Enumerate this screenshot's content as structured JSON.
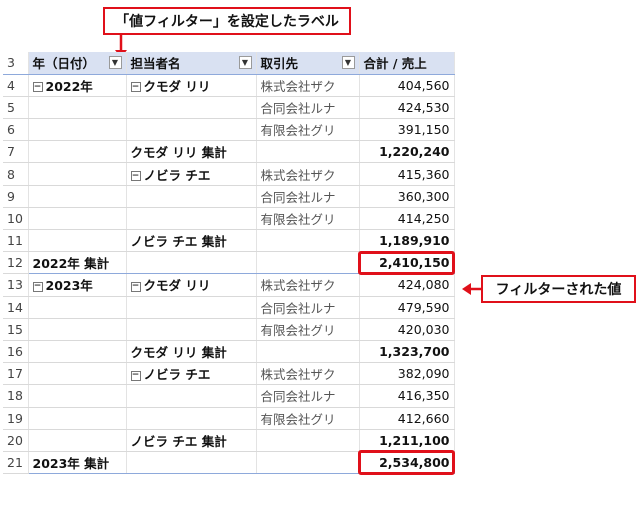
{
  "callouts": {
    "value_filter_label": "「値フィルター」を設定したラベル",
    "filtered_value": "フィルターされた値"
  },
  "headers": {
    "row": "3",
    "year": "年（日付）",
    "person": "担当者名",
    "client": "取引先",
    "sum": "合計 / 売上"
  },
  "rows": [
    {
      "n": "4",
      "year": "2022年",
      "person": "クモダ リリ",
      "client": "株式会社ザク",
      "value": "404,560"
    },
    {
      "n": "5",
      "year": "",
      "person": "",
      "client": "合同会社ルナ",
      "value": "424,530"
    },
    {
      "n": "6",
      "year": "",
      "person": "",
      "client": "有限会社グリ",
      "value": "391,150"
    },
    {
      "n": "7",
      "year": "",
      "person": "クモダ リリ 集計",
      "client": "",
      "value": "1,220,240"
    },
    {
      "n": "8",
      "year": "",
      "person": "ノビラ チエ",
      "client": "株式会社ザク",
      "value": "415,360"
    },
    {
      "n": "9",
      "year": "",
      "person": "",
      "client": "合同会社ルナ",
      "value": "360,300"
    },
    {
      "n": "10",
      "year": "",
      "person": "",
      "client": "有限会社グリ",
      "value": "414,250"
    },
    {
      "n": "11",
      "year": "",
      "person": "ノビラ チエ 集計",
      "client": "",
      "value": "1,189,910"
    },
    {
      "n": "12",
      "year": "2022年 集計",
      "person": "",
      "client": "",
      "value": "2,410,150"
    },
    {
      "n": "13",
      "year": "2023年",
      "person": "クモダ リリ",
      "client": "株式会社ザク",
      "value": "424,080"
    },
    {
      "n": "14",
      "year": "",
      "person": "",
      "client": "合同会社ルナ",
      "value": "479,590"
    },
    {
      "n": "15",
      "year": "",
      "person": "",
      "client": "有限会社グリ",
      "value": "420,030"
    },
    {
      "n": "16",
      "year": "",
      "person": "クモダ リリ 集計",
      "client": "",
      "value": "1,323,700"
    },
    {
      "n": "17",
      "year": "",
      "person": "ノビラ チエ",
      "client": "株式会社ザク",
      "value": "382,090"
    },
    {
      "n": "18",
      "year": "",
      "person": "",
      "client": "合同会社ルナ",
      "value": "416,350"
    },
    {
      "n": "19",
      "year": "",
      "person": "",
      "client": "有限会社グリ",
      "value": "412,660"
    },
    {
      "n": "20",
      "year": "",
      "person": "ノビラ チエ 集計",
      "client": "",
      "value": "1,211,100"
    },
    {
      "n": "21",
      "year": "2023年 集計",
      "person": "",
      "client": "",
      "value": "2,534,800"
    }
  ],
  "icons": {
    "collapse": "minus-box-icon",
    "filter_applied": "filter-icon",
    "dropdown": "dropdown-arrow-icon"
  },
  "colors": {
    "header_bg": "#d9e1f2",
    "highlight": "#e0101a"
  }
}
